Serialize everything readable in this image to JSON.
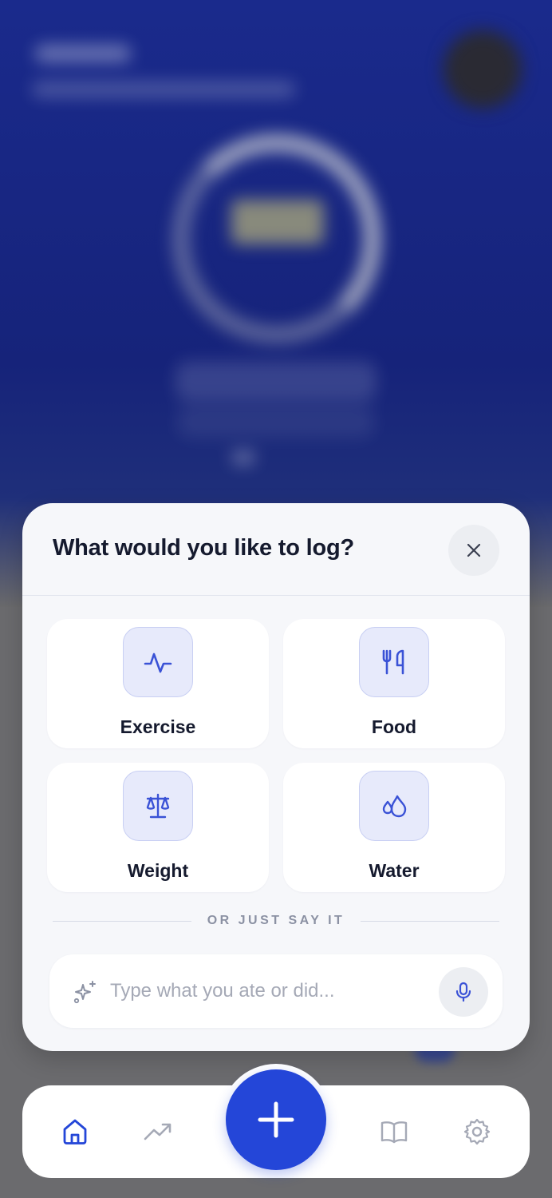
{
  "colors": {
    "accent": "#2446d8",
    "icon_tint": "#3a52d6",
    "tile_icon_bg": "#e7eafb",
    "sheet_bg": "#f6f7fa",
    "title_text": "#151a2e",
    "muted_text": "#8b91a3"
  },
  "log_sheet": {
    "title": "What would you like to log?",
    "close_icon": "close-icon",
    "options": [
      {
        "label": "Exercise",
        "icon": "activity-pulse-icon"
      },
      {
        "label": "Food",
        "icon": "utensils-icon"
      },
      {
        "label": "Weight",
        "icon": "scale-icon"
      },
      {
        "label": "Water",
        "icon": "water-drops-icon"
      }
    ],
    "divider_text": "OR JUST SAY IT",
    "input": {
      "value": "",
      "placeholder": "Type what you ate or did...",
      "leading_icon": "sparkles-icon",
      "mic_icon": "microphone-icon"
    }
  },
  "bottom_nav": {
    "items": [
      {
        "name": "home",
        "icon": "home-icon",
        "active": true
      },
      {
        "name": "trends",
        "icon": "trending-up-icon",
        "active": false
      },
      {
        "name": "journal",
        "icon": "book-icon",
        "active": false
      },
      {
        "name": "settings",
        "icon": "gear-icon",
        "active": false
      }
    ],
    "fab_icon": "plus-icon"
  }
}
